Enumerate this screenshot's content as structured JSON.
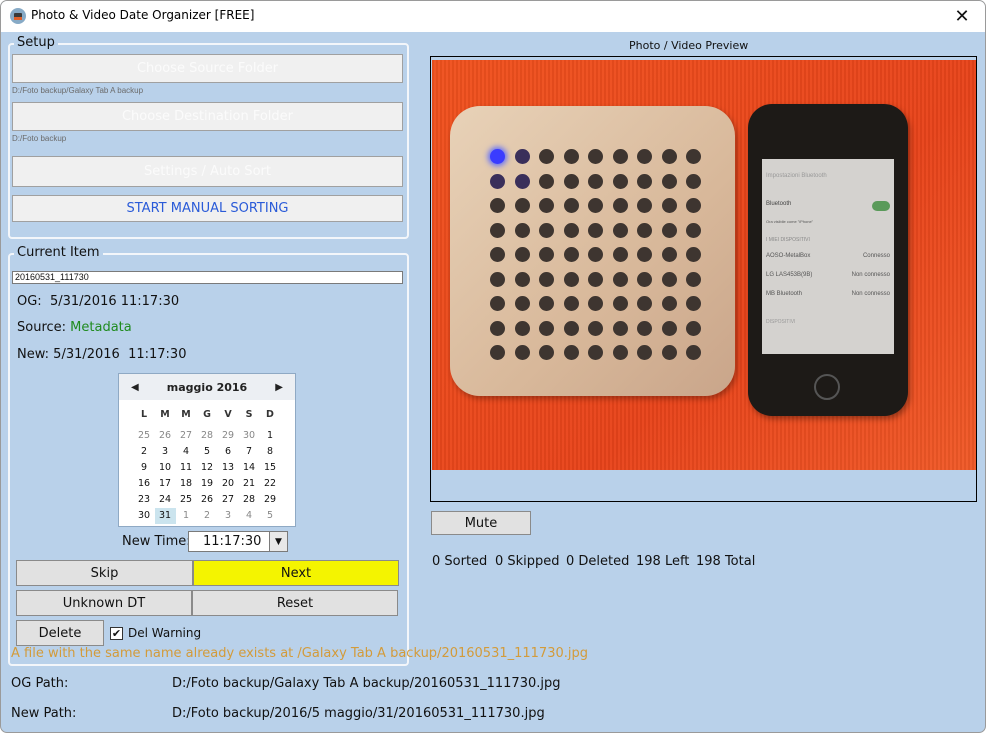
{
  "window": {
    "title": "Photo & Video Date Organizer [FREE]",
    "close_icon": "close-icon"
  },
  "setup": {
    "legend": "Setup",
    "choose_source_label": "Choose Source Folder",
    "source_path": "D:/Foto backup/Galaxy Tab A backup",
    "choose_destination_label": "Choose Destination Folder",
    "destination_path": "D:/Foto backup",
    "settings_label": "Settings / Auto Sort",
    "start_label": "START MANUAL SORTING"
  },
  "current_item": {
    "legend": "Current Item",
    "filename": "20160531_111730",
    "og_label": "OG:",
    "og_value": "5/31/2016 11:17:30",
    "source_label": "Source:",
    "source_value": "Metadata",
    "new_label": "New:",
    "new_value": "5/31/2016  11:17:30",
    "calendar": {
      "month_label": "maggio 2016",
      "weekdays": [
        "L",
        "M",
        "M",
        "G",
        "V",
        "S",
        "D"
      ],
      "weeks": [
        [
          "25",
          "26",
          "27",
          "28",
          "29",
          "30",
          "1"
        ],
        [
          "2",
          "3",
          "4",
          "5",
          "6",
          "7",
          "8"
        ],
        [
          "9",
          "10",
          "11",
          "12",
          "13",
          "14",
          "15"
        ],
        [
          "16",
          "17",
          "18",
          "19",
          "20",
          "21",
          "22"
        ],
        [
          "23",
          "24",
          "25",
          "26",
          "27",
          "28",
          "29"
        ],
        [
          "30",
          "31",
          "1",
          "2",
          "3",
          "4",
          "5"
        ]
      ],
      "selected_day": "31"
    },
    "new_time_label": "New Time:",
    "new_time_value": "11:17:30",
    "skip_label": "Skip",
    "next_label": "Next",
    "unknown_dt_label": "Unknown DT",
    "reset_label": "Reset",
    "delete_label": "Delete",
    "del_warning_label": "Del Warning",
    "del_warning_checked": true,
    "warning_text": "A file with the same name already exists at /Galaxy Tab A backup/20160531_111730.jpg"
  },
  "paths": {
    "og_path_label": "OG Path:",
    "og_path_value": "D:/Foto backup/Galaxy Tab A backup/20160531_111730.jpg",
    "new_path_label": "New Path:",
    "new_path_value": "D:/Foto backup/2016/5 maggio/31/20160531_111730.jpg"
  },
  "preview": {
    "title": "Photo / Video Preview",
    "image_description": "Photo of a beige square speaker with a blue LED next to an iPhone showing Bluetooth settings on an orange background",
    "phone_screen": {
      "header": "Impostazioni  Bluetooth",
      "bluetooth_label": "Bluetooth",
      "visible_as": "Ora visibile come \"iPhone\"",
      "section": "I MIEI DISPOSITIVI",
      "devices": [
        {
          "name": "AOSO-MetalBox",
          "status": "Connesso"
        },
        {
          "name": "LG LAS453B(9B)",
          "status": "Non connesso"
        },
        {
          "name": "MB Bluetooth",
          "status": "Non connesso"
        }
      ],
      "footer": "DISPOSITIVI"
    },
    "mute_label": "Mute"
  },
  "stats": {
    "sorted": "0 Sorted",
    "skipped": "0 Skipped",
    "deleted": "0 Deleted",
    "left": "198 Left",
    "total": "198 Total"
  },
  "colors": {
    "background": "#b9d1ea",
    "next_button": "#f4f400",
    "start_text": "#2a5bd8",
    "source_green": "#1f8b1f",
    "warning": "#d39b3a"
  }
}
